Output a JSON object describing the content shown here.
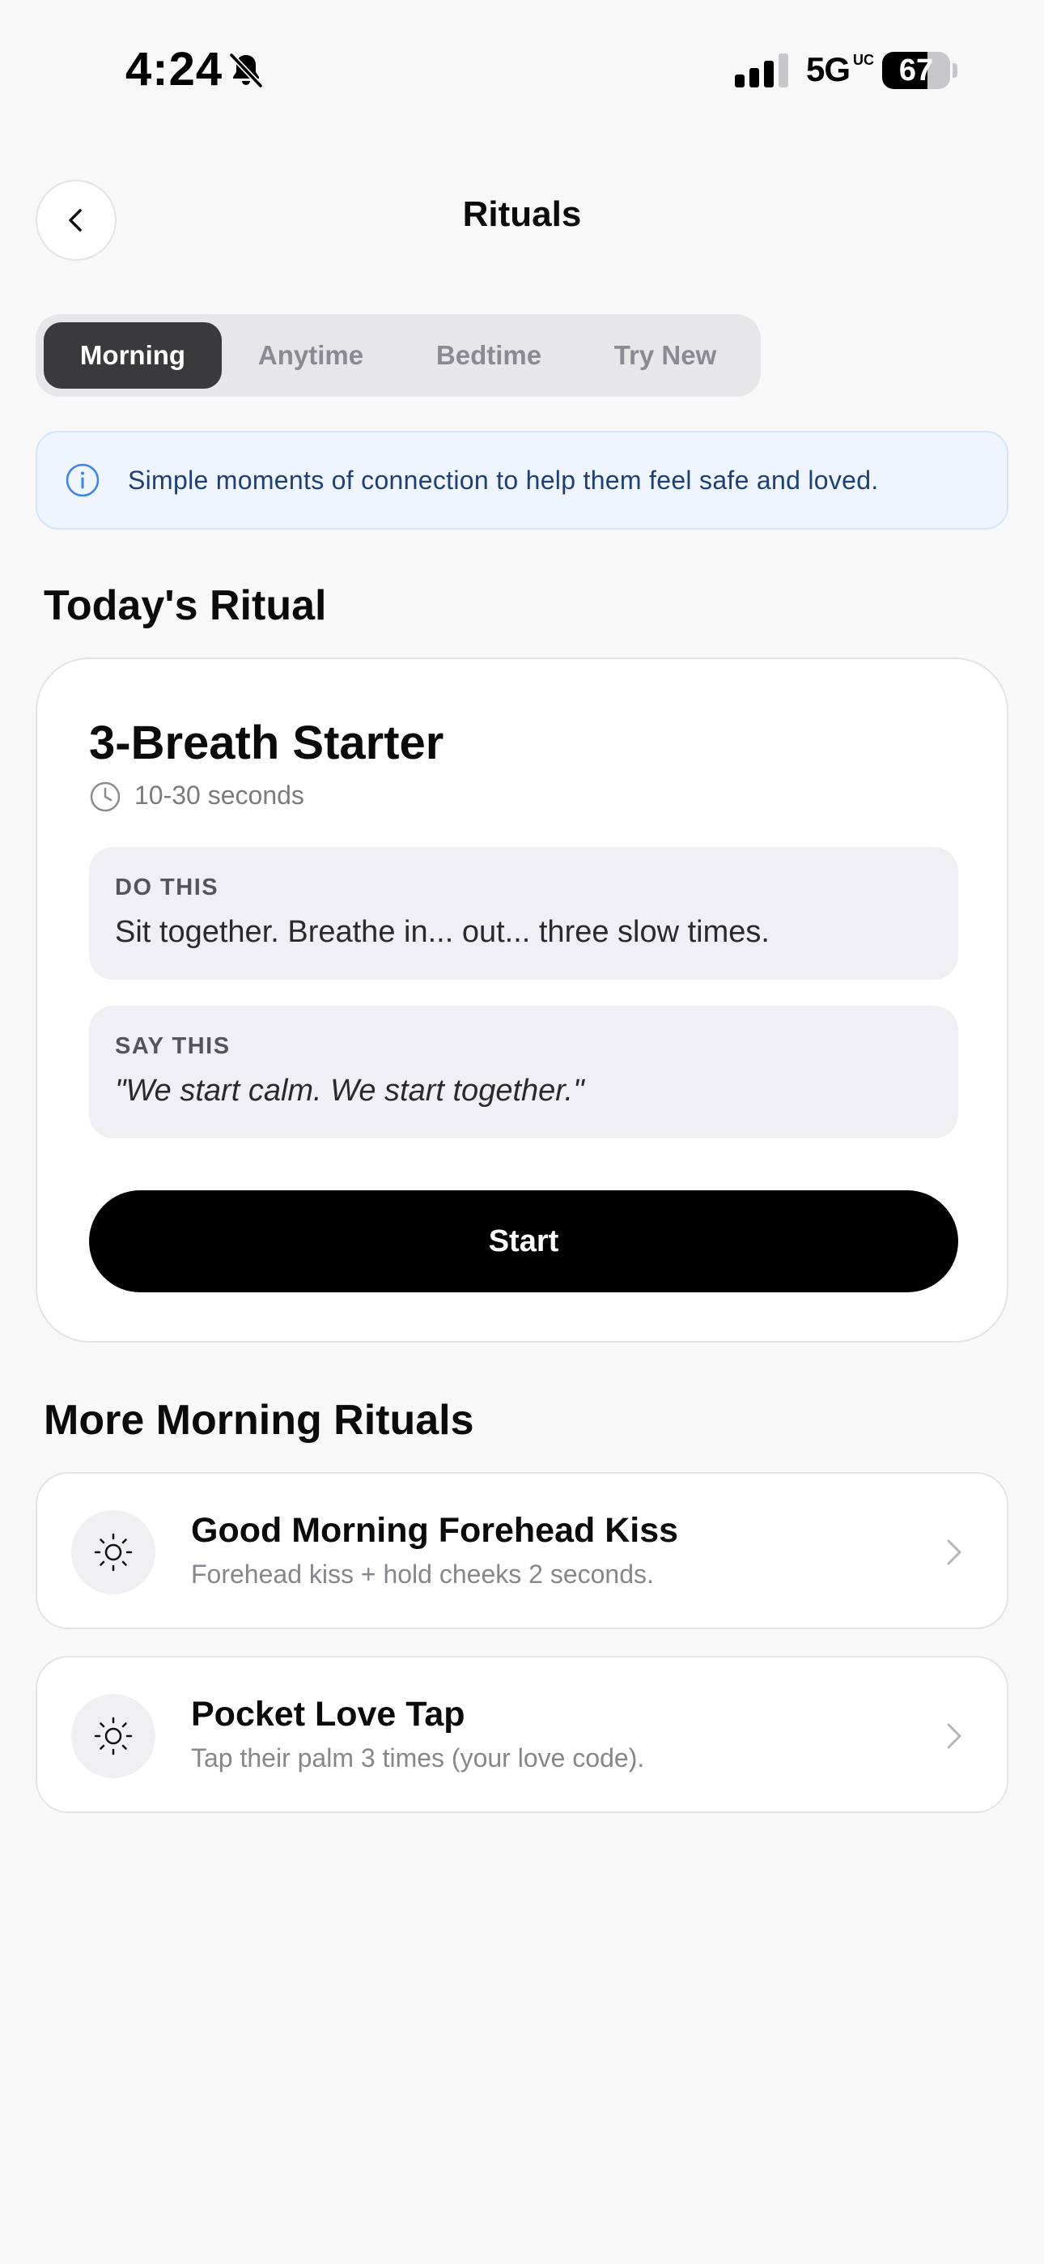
{
  "status_bar": {
    "time": "4:24",
    "network": "5G",
    "network_sub": "UC",
    "battery_level": 67,
    "battery_text": "67"
  },
  "header": {
    "title": "Rituals",
    "back_icon": "chevron-left-icon"
  },
  "tabs": [
    {
      "label": "Morning",
      "active": true
    },
    {
      "label": "Anytime",
      "active": false
    },
    {
      "label": "Bedtime",
      "active": false
    },
    {
      "label": "Try New",
      "active": false
    }
  ],
  "info_banner": {
    "icon": "info-icon",
    "text": "Simple moments of connection to help them feel safe and loved."
  },
  "todays_ritual": {
    "section_title": "Today's Ritual",
    "name": "3-Breath Starter",
    "duration": "10-30 seconds",
    "do_this": {
      "label": "DO THIS",
      "text": "Sit together. Breathe in... out... three slow times."
    },
    "say_this": {
      "label": "SAY THIS",
      "text": "\"We start calm. We start together.\""
    },
    "start_label": "Start"
  },
  "more_rituals": {
    "section_title": "More Morning Rituals",
    "items": [
      {
        "icon": "sun-icon",
        "title": "Good Morning Forehead Kiss",
        "subtitle": "Forehead kiss + hold cheeks 2 seconds."
      },
      {
        "icon": "sun-icon",
        "title": "Pocket Love Tap",
        "subtitle": "Tap their palm 3 times (your love code)."
      }
    ]
  },
  "colors": {
    "background": "#f8f8f9",
    "active_tab": "#3a3a3c",
    "info_bg": "#eef5fe",
    "info_text": "#1e3f7a",
    "primary_button": "#000000"
  }
}
